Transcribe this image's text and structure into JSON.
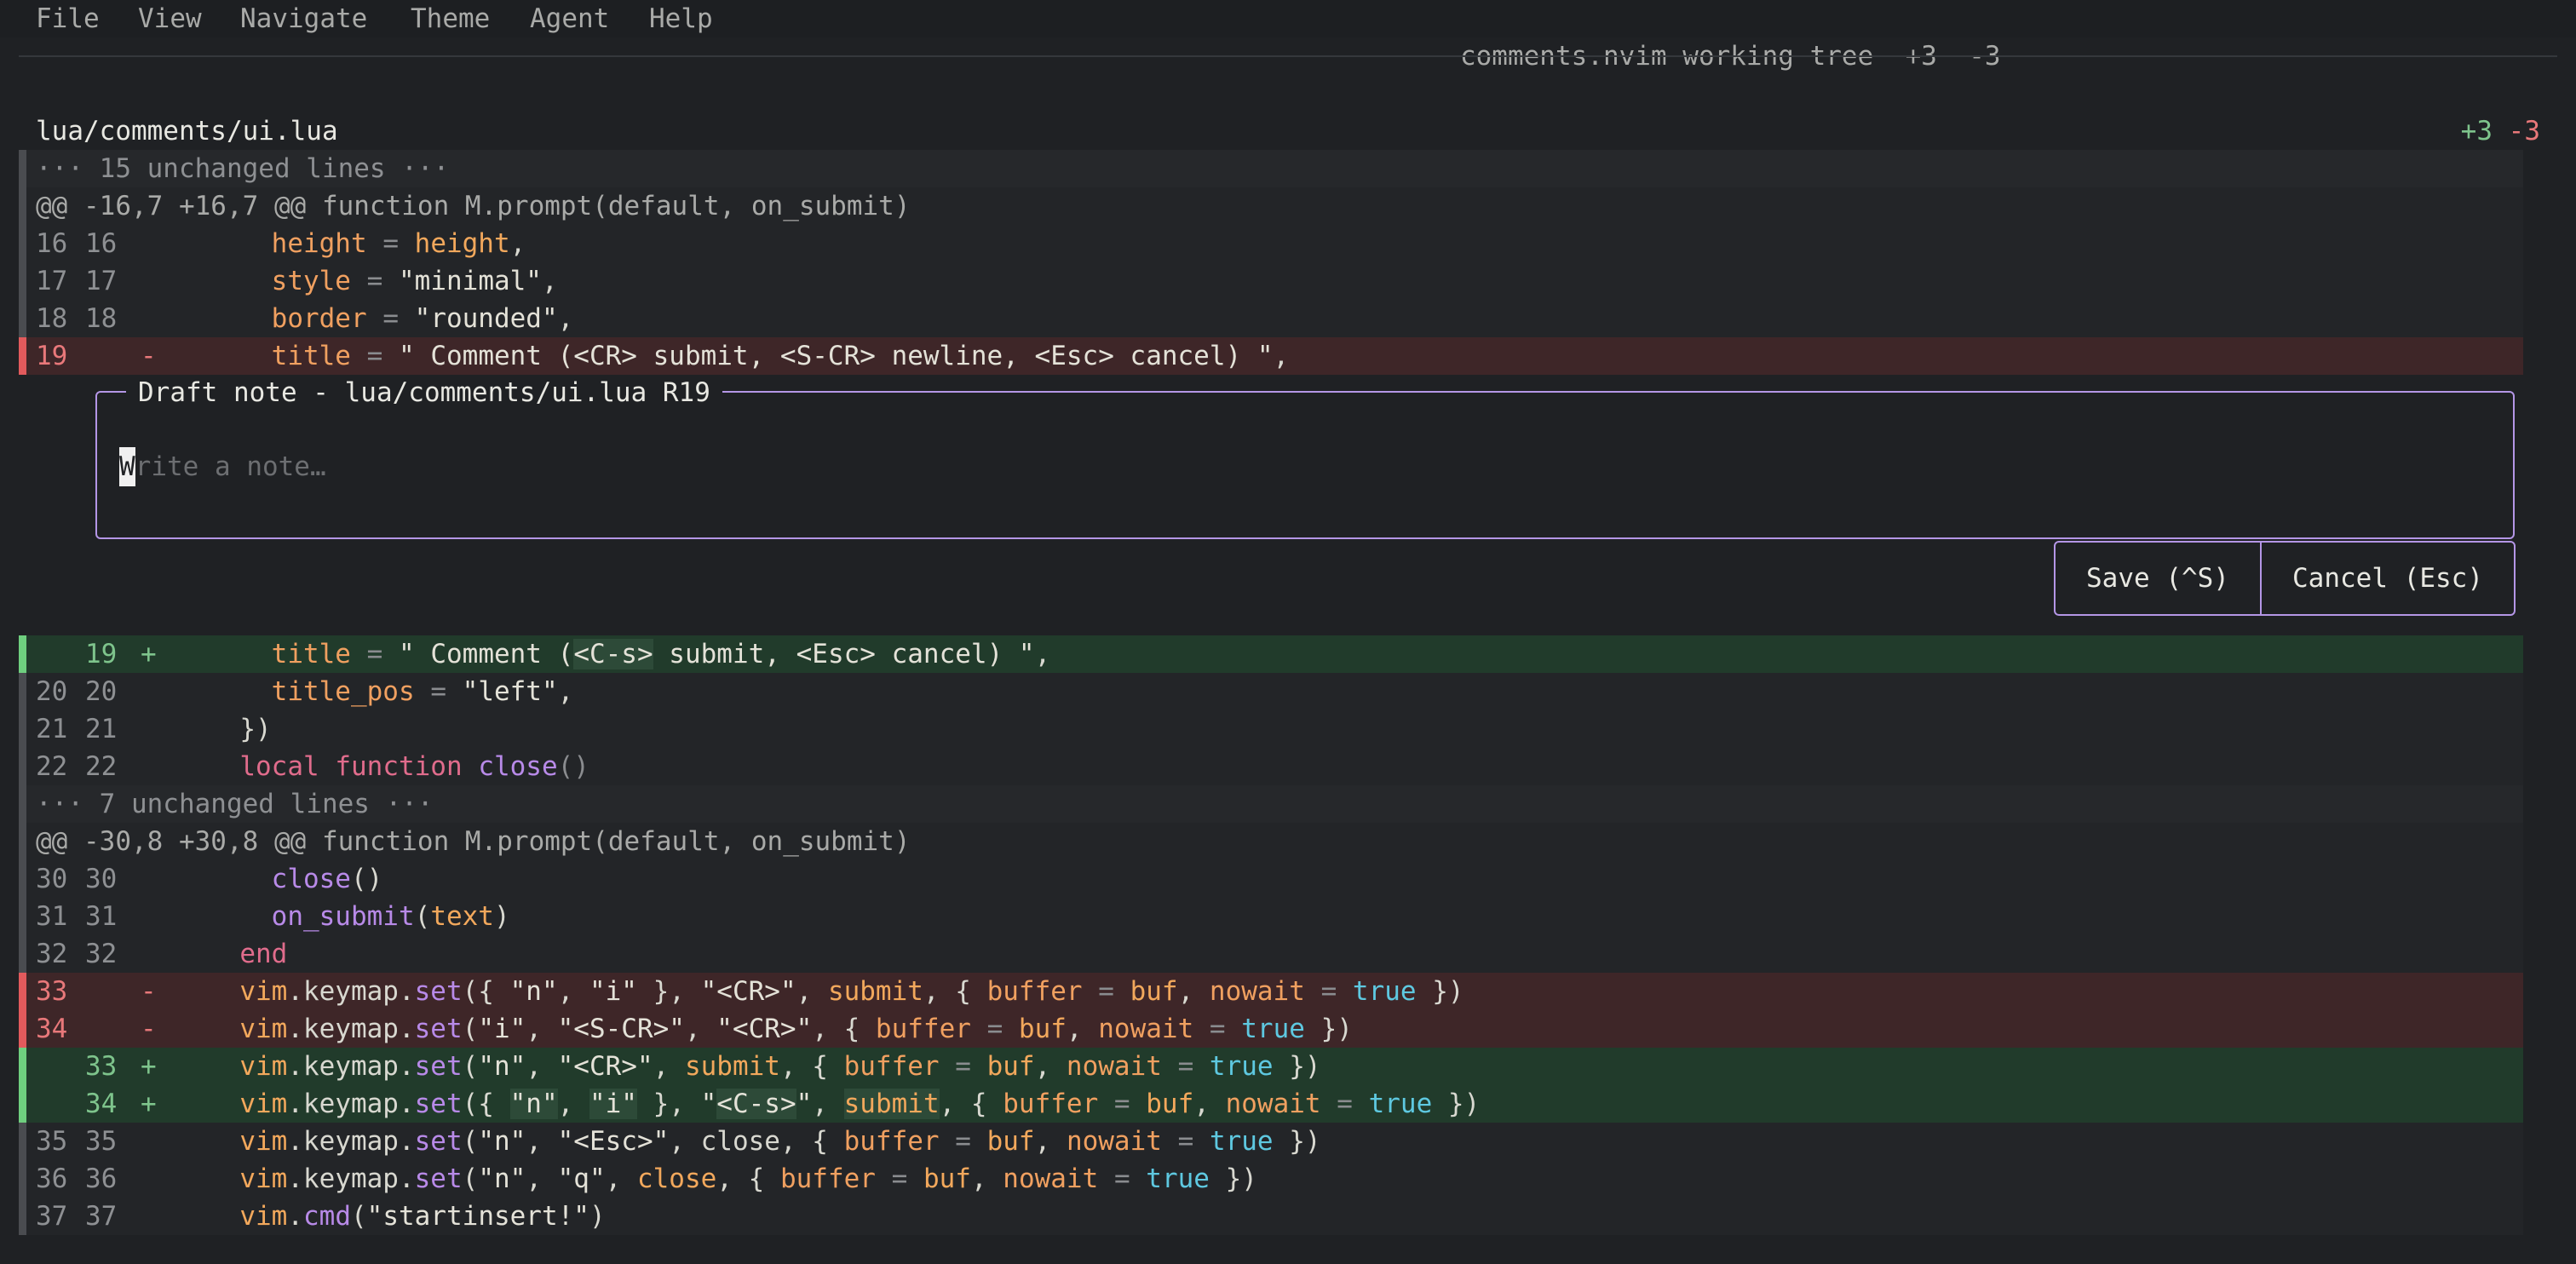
{
  "menu": [
    "File",
    "View",
    "Navigate",
    "Theme",
    "Agent",
    "Help"
  ],
  "window": {
    "title": "comments.nvim working tree",
    "added": "+3",
    "removed": "-3"
  },
  "file": {
    "path": "lua/comments/ui.lua",
    "added": "+3",
    "removed": "-3"
  },
  "folds": [
    "··· 15 unchanged lines ···",
    "··· 7 unchanged lines ···"
  ],
  "hunks": [
    "@@ -16,7 +16,7 @@ function M.prompt(default, on_submit)",
    "@@ -30,8 +30,8 @@ function M.prompt(default, on_submit)"
  ],
  "lines": {
    "l16": {
      "old": "16",
      "new": "16"
    },
    "l17": {
      "old": "17",
      "new": "17"
    },
    "l18": {
      "old": "18",
      "new": "18"
    },
    "l19d": {
      "old": "19",
      "sign": "-"
    },
    "l19a": {
      "new": "19",
      "sign": "+"
    },
    "l20": {
      "old": "20",
      "new": "20"
    },
    "l21": {
      "old": "21",
      "new": "21"
    },
    "l22": {
      "old": "22",
      "new": "22"
    },
    "l30": {
      "old": "30",
      "new": "30"
    },
    "l31": {
      "old": "31",
      "new": "31"
    },
    "l32": {
      "old": "32",
      "new": "32"
    },
    "l33d": {
      "old": "33",
      "sign": "-"
    },
    "l34d": {
      "old": "34",
      "sign": "-"
    },
    "l33a": {
      "new": "33",
      "sign": "+"
    },
    "l34a": {
      "new": "34",
      "sign": "+"
    },
    "l35": {
      "old": "35",
      "new": "35"
    },
    "l36": {
      "old": "36",
      "new": "36"
    },
    "l37": {
      "old": "37",
      "new": "37"
    }
  },
  "note": {
    "title": "Draft note - lua/comments/ui.lua R19",
    "caret_char": "W",
    "placeholder_rest": "rite a note…",
    "placeholder": "Write a note…",
    "save_label": "Save (^S)",
    "cancel_label": "Cancel (Esc)"
  },
  "colors": {
    "added": "#7ec48c",
    "removed": "#e8787a",
    "note_border": "#b496e6",
    "background": "#1f2124"
  }
}
